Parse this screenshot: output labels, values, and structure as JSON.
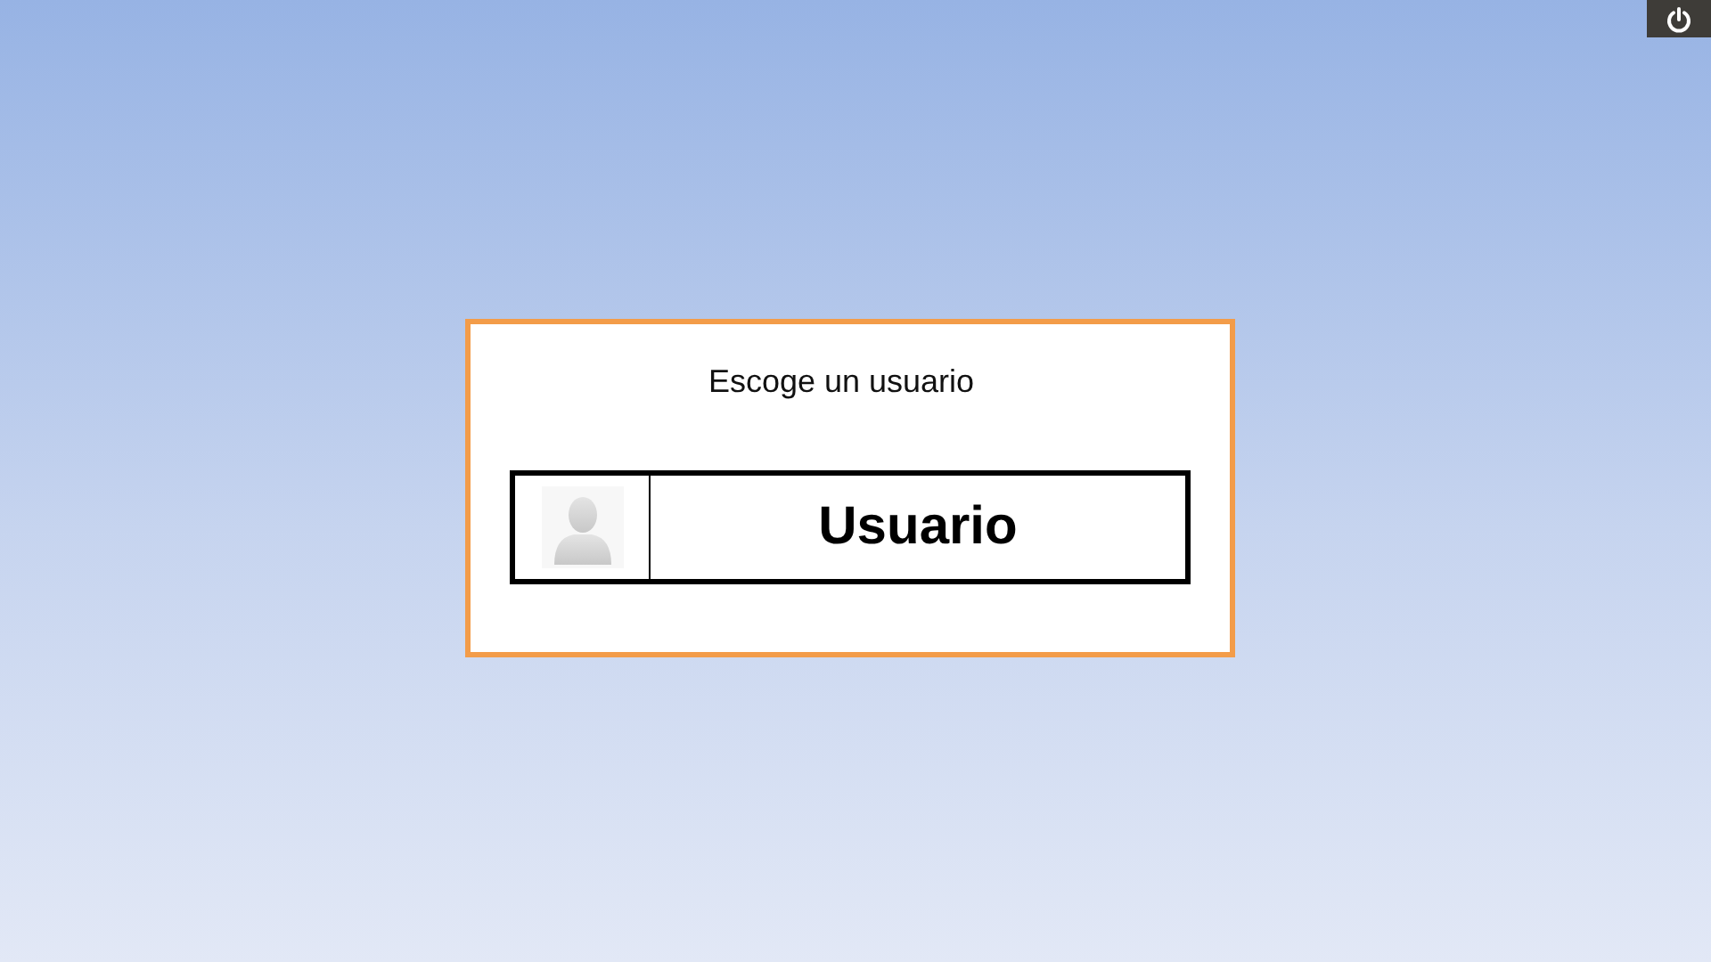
{
  "dialog": {
    "title": "Escoge un usuario",
    "users": [
      {
        "name": "Usuario"
      }
    ]
  }
}
